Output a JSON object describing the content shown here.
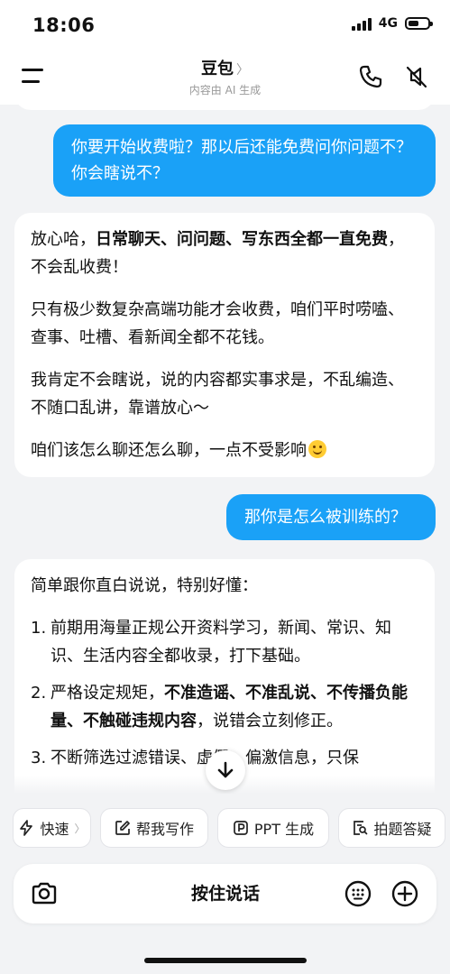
{
  "status": {
    "time": "18:06",
    "network": "4G"
  },
  "header": {
    "title": "豆包",
    "title_chevron": "〉",
    "subtitle": "内容由 AI 生成"
  },
  "messages": {
    "user1": "你要开始收费啦？那以后还能免费问你问题不？你会瞎说不？",
    "ai1": {
      "p1_pre": "放心哈，",
      "p1_bold": "日常聊天、问问题、写东西全都一直免费",
      "p1_post": "，不会乱收费！",
      "p2": "只有极少数复杂高端功能才会收费，咱们平时唠嗑、查事、吐槽、看新闻全都不花钱。",
      "p3": "我肯定不会瞎说，说的内容都实事求是，不乱编造、不随口乱讲，靠谱放心～",
      "p4": "咱们该怎么聊还怎么聊，一点不受影响"
    },
    "user2": "那你是怎么被训练的？",
    "ai2": {
      "intro": "简单跟你直白说说，特别好懂：",
      "item1_num": "1.",
      "item1": "前期用海量正规公开资料学习，新闻、常识、知识、生活内容全都收录，打下基础。",
      "item2_num": "2.",
      "item2_pre": "严格设定规矩，",
      "item2_bold": "不准造谣、不准乱说、不传播负能量、不触碰违规内容",
      "item2_post": "，说错会立刻修正。",
      "item3_num": "3.",
      "item3": "不断筛选过滤错误、虚假、偏激信息，只保"
    }
  },
  "chips": [
    {
      "label": "快速",
      "icon": "lightning-icon"
    },
    {
      "label": "帮我写作",
      "icon": "edit-icon"
    },
    {
      "label": "PPT 生成",
      "icon": "ppt-icon"
    },
    {
      "label": "拍题答疑",
      "icon": "scan-question-icon"
    }
  ],
  "input": {
    "hold_to_talk": "按住说话"
  }
}
